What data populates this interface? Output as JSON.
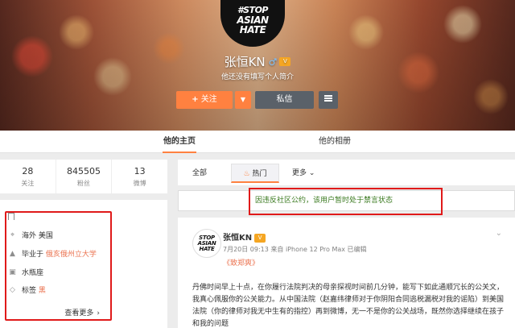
{
  "cover": {
    "avatar_lines": [
      "#STOP",
      "ASIAN",
      "HATE"
    ],
    "name": "张恒KN",
    "gender_symbol": "♂",
    "level_badge": "V",
    "bio": "他还没有填写个人简介",
    "follow_label": "关注",
    "follow_plus": "+",
    "dropdown_glyph": "▼",
    "message_label": "私信"
  },
  "nav": {
    "tabs": [
      {
        "label": "他的主页",
        "active": true
      },
      {
        "label": "他的相册",
        "active": false
      }
    ]
  },
  "stats": [
    {
      "value": "28",
      "label": "关注"
    },
    {
      "value": "845505",
      "label": "粉丝"
    },
    {
      "value": "13",
      "label": "微博"
    }
  ],
  "info": {
    "location": "海外 美国",
    "education_prefix": "毕业于",
    "education_school": "俄亥俄州立大学",
    "sign": "水瓶座",
    "tags_prefix": "标签",
    "tags_value": "黑",
    "see_more": "查看更多",
    "see_more_chevron": "›"
  },
  "filter": {
    "all": "全部",
    "hot": "热门",
    "more": "更多",
    "more_chevron": "⌄"
  },
  "notice": {
    "text": "因违反社区公约，该用户暂时处于禁言状态"
  },
  "post": {
    "avatar_lines": [
      "STOP",
      "ASIAN",
      "HATE"
    ],
    "author": "张恒KN",
    "level_badge": "V",
    "meta": "7月20日 09:13 来自 iPhone 12 Pro Max  已编辑",
    "title": "《致郑爽》",
    "body_1": "丹佛时间早上十点，在你履行法院判决的母亲探视时间前几分钟，能写下如此通顺冗长的公关文，我真心佩服你的公关能力。从中国法院（赵嘉纬律师对于你阴阳合同逃税漏税对我的谣陷）到美国法院（你的律师对我无中生有的指控）再到微博，无一不是你的公关战场，既然你选择继续在孩子和我的问题",
    "chevron": "⌄"
  },
  "colors": {
    "accent": "#ff8140",
    "notice_green": "#3a7a1f",
    "annotation_red": "#e01a1a"
  }
}
